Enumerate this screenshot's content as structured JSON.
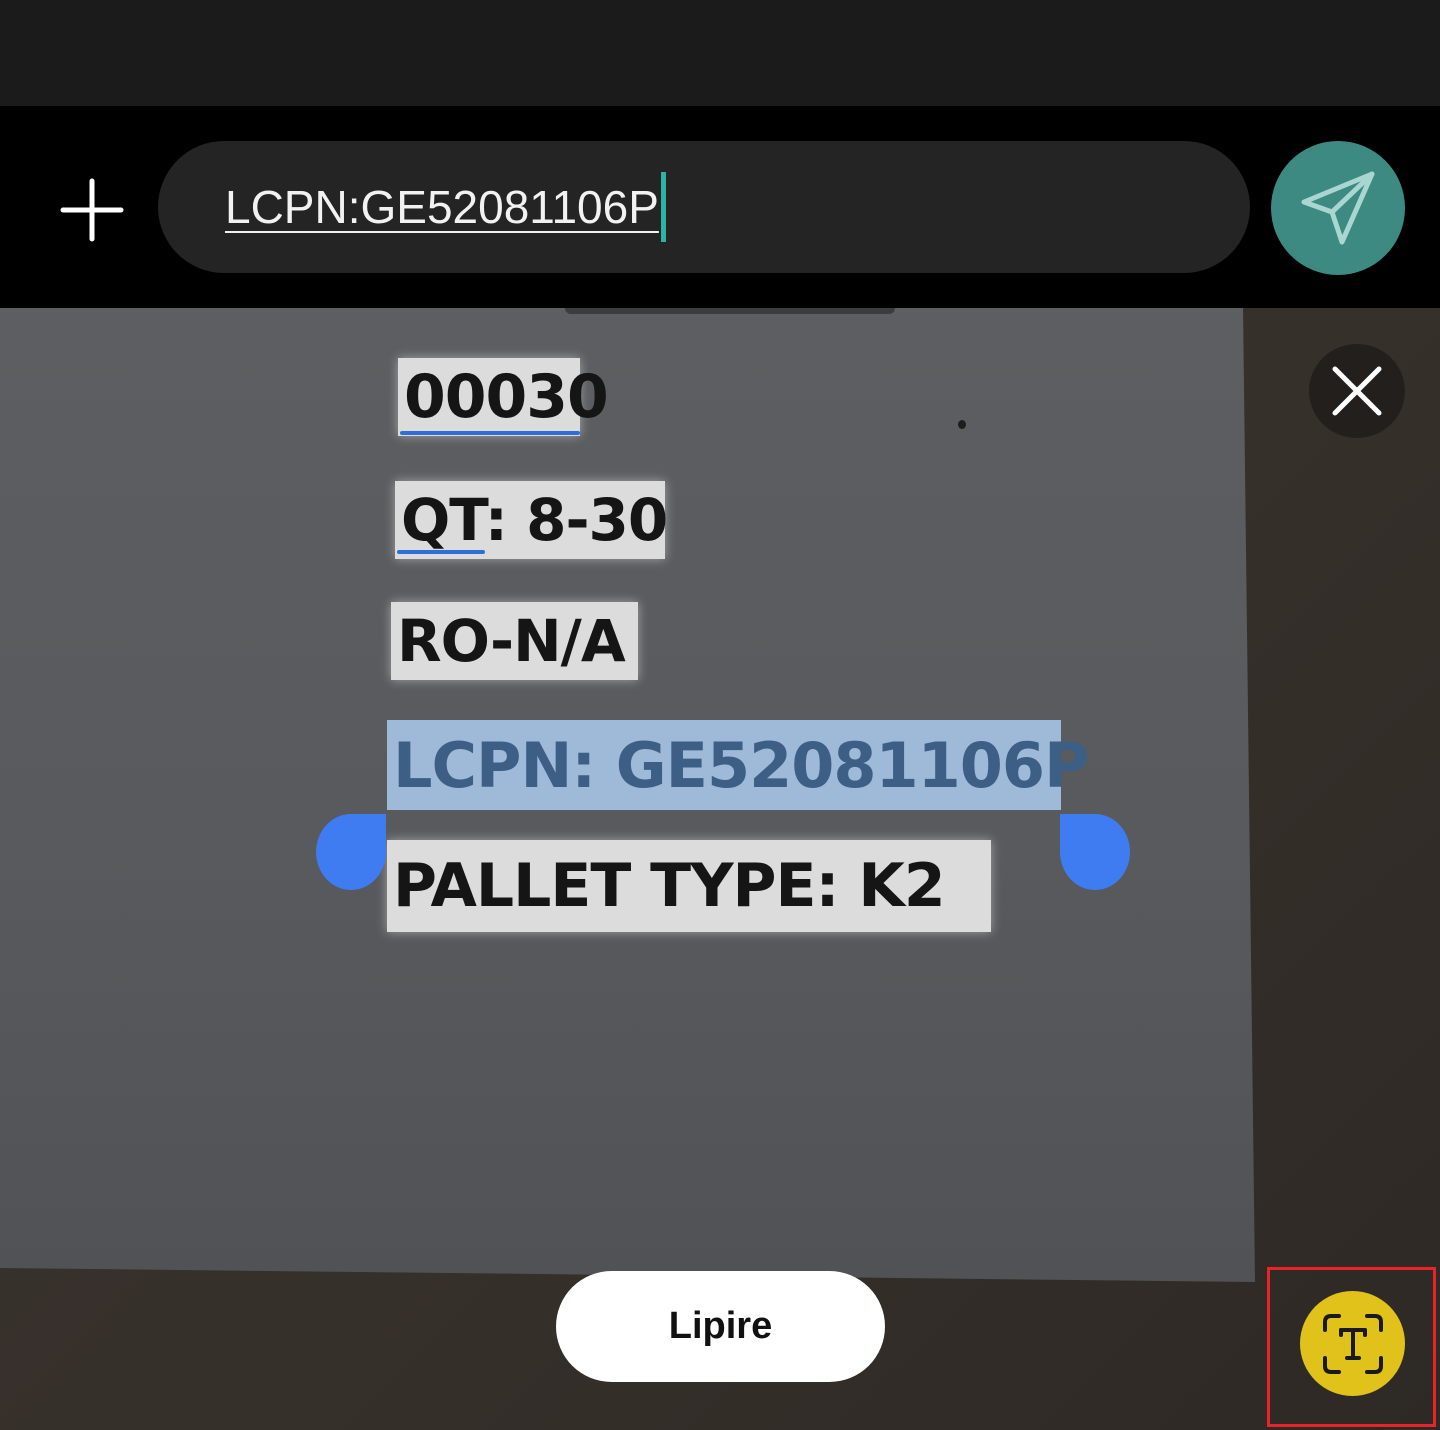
{
  "input_bar": {
    "text_value": "LCPN:GE52081106P",
    "add_icon": "plus-icon",
    "send_icon": "paper-plane-icon",
    "send_color": "#3d8a82",
    "caret_color": "#2fb2a4"
  },
  "scanned_lines": [
    {
      "text": "00030"
    },
    {
      "text": "QT: 8-30"
    },
    {
      "text": "RO-N/A"
    },
    {
      "text": "LCPN: GE52081106P",
      "selected": true
    },
    {
      "text": "PALLET TYPE: K2"
    }
  ],
  "selection_color": "#9fbad8",
  "handle_color": "#3f7cf2",
  "close_icon": "close-icon",
  "read_button": {
    "label": "Lipire"
  },
  "scan_text_button": {
    "icon": "text-scan-icon",
    "color": "#e0c21a"
  },
  "highlight_color": "#e8232a"
}
